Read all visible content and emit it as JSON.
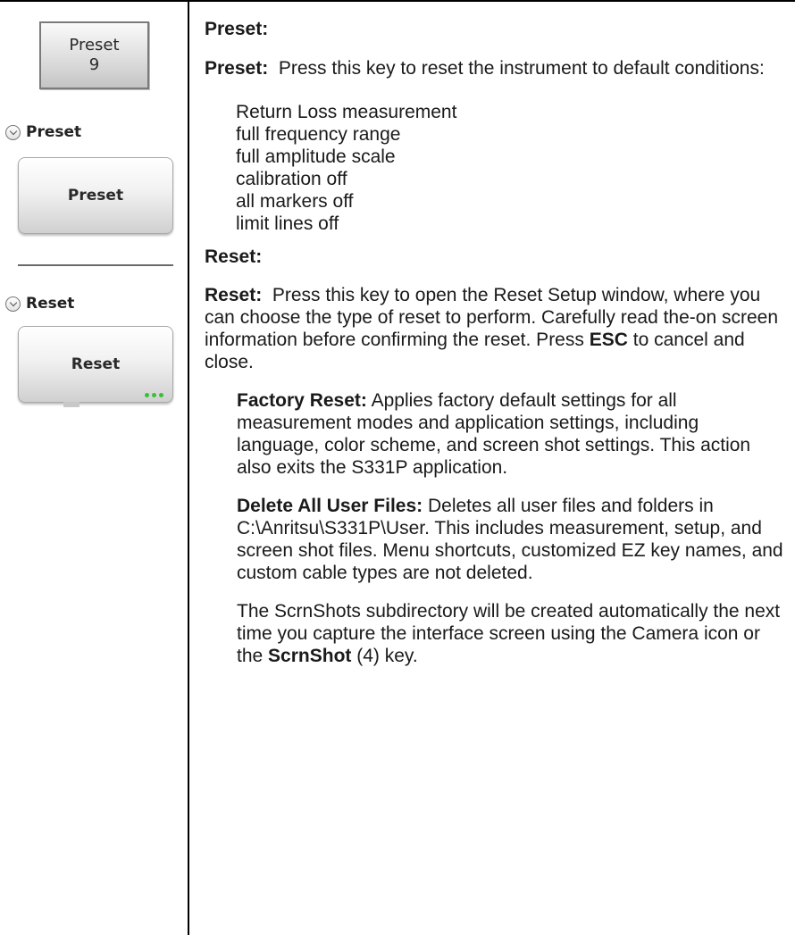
{
  "left": {
    "keypad_button": {
      "line1": "Preset",
      "line2": "9"
    },
    "preset_section": {
      "label": "Preset",
      "button": "Preset"
    },
    "reset_section": {
      "label": "Reset",
      "button": "Reset"
    }
  },
  "content": {
    "preset_heading": "Preset:",
    "preset_term": "Preset:",
    "preset_desc": "Press this key to reset the instrument to default conditions:",
    "preset_conditions": [
      "Return Loss measurement",
      "full frequency range",
      "full amplitude scale",
      "calibration off",
      "all markers off",
      "limit lines off"
    ],
    "reset_heading": "Reset:",
    "reset_term": "Reset:",
    "reset_desc_1": "Press this key to open the Reset Setup window, where you can choose the type of reset to perform. Carefully read the-on screen information before confirming the reset. Press",
    "reset_desc_esc": "ESC",
    "reset_desc_2": "to cancel and close.",
    "factory_reset_term": "Factory Reset:",
    "factory_reset_desc": "Applies factory default settings for all measurement modes and application settings, including language, color scheme, and screen shot settings. This action also exits the S331P application.",
    "delete_term": "Delete All User Files:",
    "delete_desc": "Deletes all user files and folders in C:\\Anritsu\\S331P\\User. This includes measurement, setup, and screen shot files. Menu shortcuts, customized EZ key names, and custom cable types are not deleted.",
    "scrnshots_desc_1": "The ScrnShots subdirectory will be created automatically the next time you capture the interface screen using the Camera icon or the",
    "scrnshots_key": "ScrnShot",
    "scrnshots_desc_2": "(4) key."
  }
}
